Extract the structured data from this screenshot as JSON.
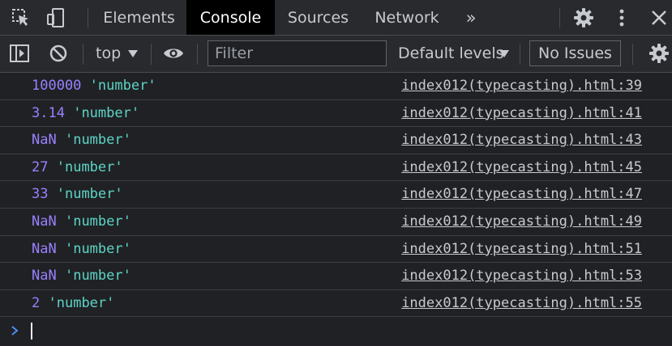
{
  "tabs": [
    {
      "label": "Elements",
      "active": false
    },
    {
      "label": "Console",
      "active": true
    },
    {
      "label": "Sources",
      "active": false
    },
    {
      "label": "Network",
      "active": false
    }
  ],
  "more_tabs_label": "»",
  "toolbar": {
    "context": "top",
    "filter_placeholder": "Filter",
    "levels": "Default levels",
    "issues": "No Issues"
  },
  "console_messages": [
    {
      "value": "100000",
      "type": "'number'",
      "source": "index012(typecasting).html:39"
    },
    {
      "value": "3.14",
      "type": "'number'",
      "source": "index012(typecasting).html:41"
    },
    {
      "value": "NaN",
      "type": "'number'",
      "source": "index012(typecasting).html:43"
    },
    {
      "value": "27",
      "type": "'number'",
      "source": "index012(typecasting).html:45"
    },
    {
      "value": "33",
      "type": "'number'",
      "source": "index012(typecasting).html:47"
    },
    {
      "value": "NaN",
      "type": "'number'",
      "source": "index012(typecasting).html:49"
    },
    {
      "value": "NaN",
      "type": "'number'",
      "source": "index012(typecasting).html:51"
    },
    {
      "value": "NaN",
      "type": "'number'",
      "source": "index012(typecasting).html:53"
    },
    {
      "value": "2",
      "type": "'number'",
      "source": "index012(typecasting).html:55"
    }
  ],
  "colors": {
    "background": "#202124",
    "toolbar": "#292a2d",
    "value": "#9980ff",
    "type_string": "#5cd5c6",
    "link": "#c7cad0",
    "prompt": "#4d8ef7"
  }
}
